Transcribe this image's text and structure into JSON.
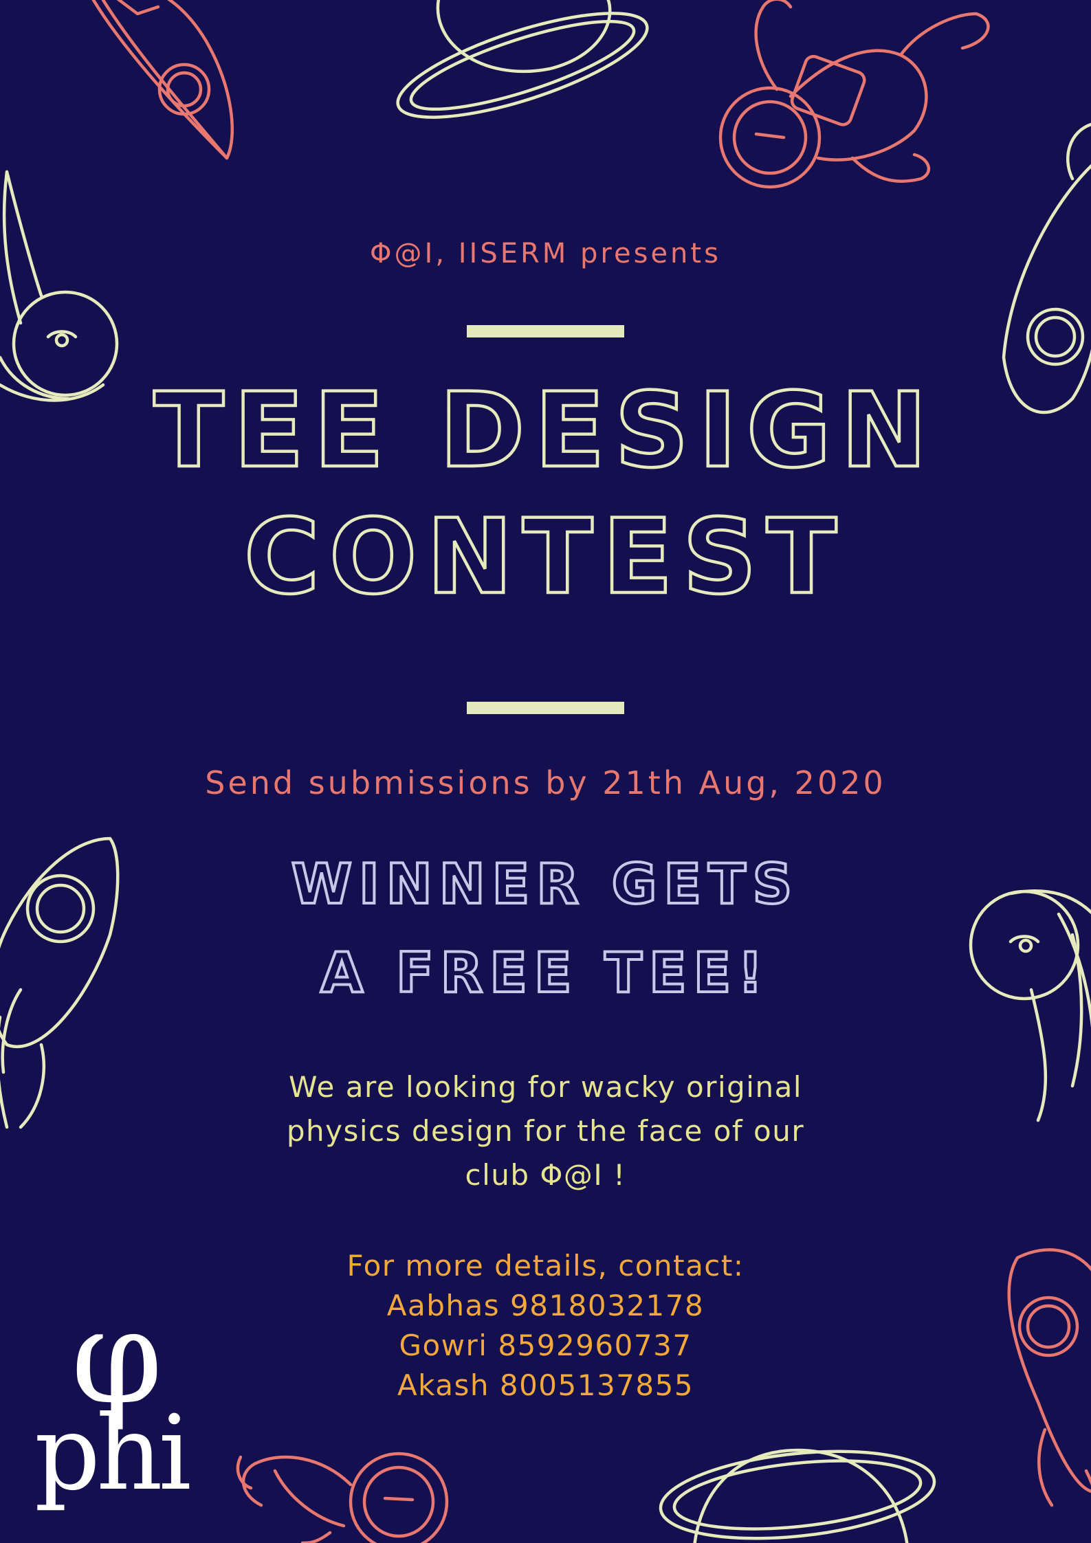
{
  "poster": {
    "presenter": "Φ@I, IISERM presents",
    "title_line1": "TEE DESIGN",
    "title_line2": "CONTEST",
    "deadline": "Send submissions by 21th Aug, 2020",
    "prize_line1": "WINNER GETS",
    "prize_line2": "A FREE TEE!",
    "description": [
      "We are looking for wacky original",
      "physics design for the face of our",
      "club Φ@I !"
    ],
    "contact_heading": "For more details, contact:",
    "contacts": [
      "Aabhas 9818032178",
      "Gowri 8592960737",
      "Akash 8005137855"
    ],
    "logo_symbol": "φ",
    "logo_text": "phi"
  },
  "colors": {
    "background": "#14104f",
    "cream": "#e6ebbd",
    "coral": "#e8776f",
    "yellow": "#e6e48e",
    "orange": "#f2a83a"
  },
  "icons": [
    "rocket-icon",
    "planet-icon",
    "astronaut-icon",
    "comet-icon",
    "phi-logo"
  ]
}
